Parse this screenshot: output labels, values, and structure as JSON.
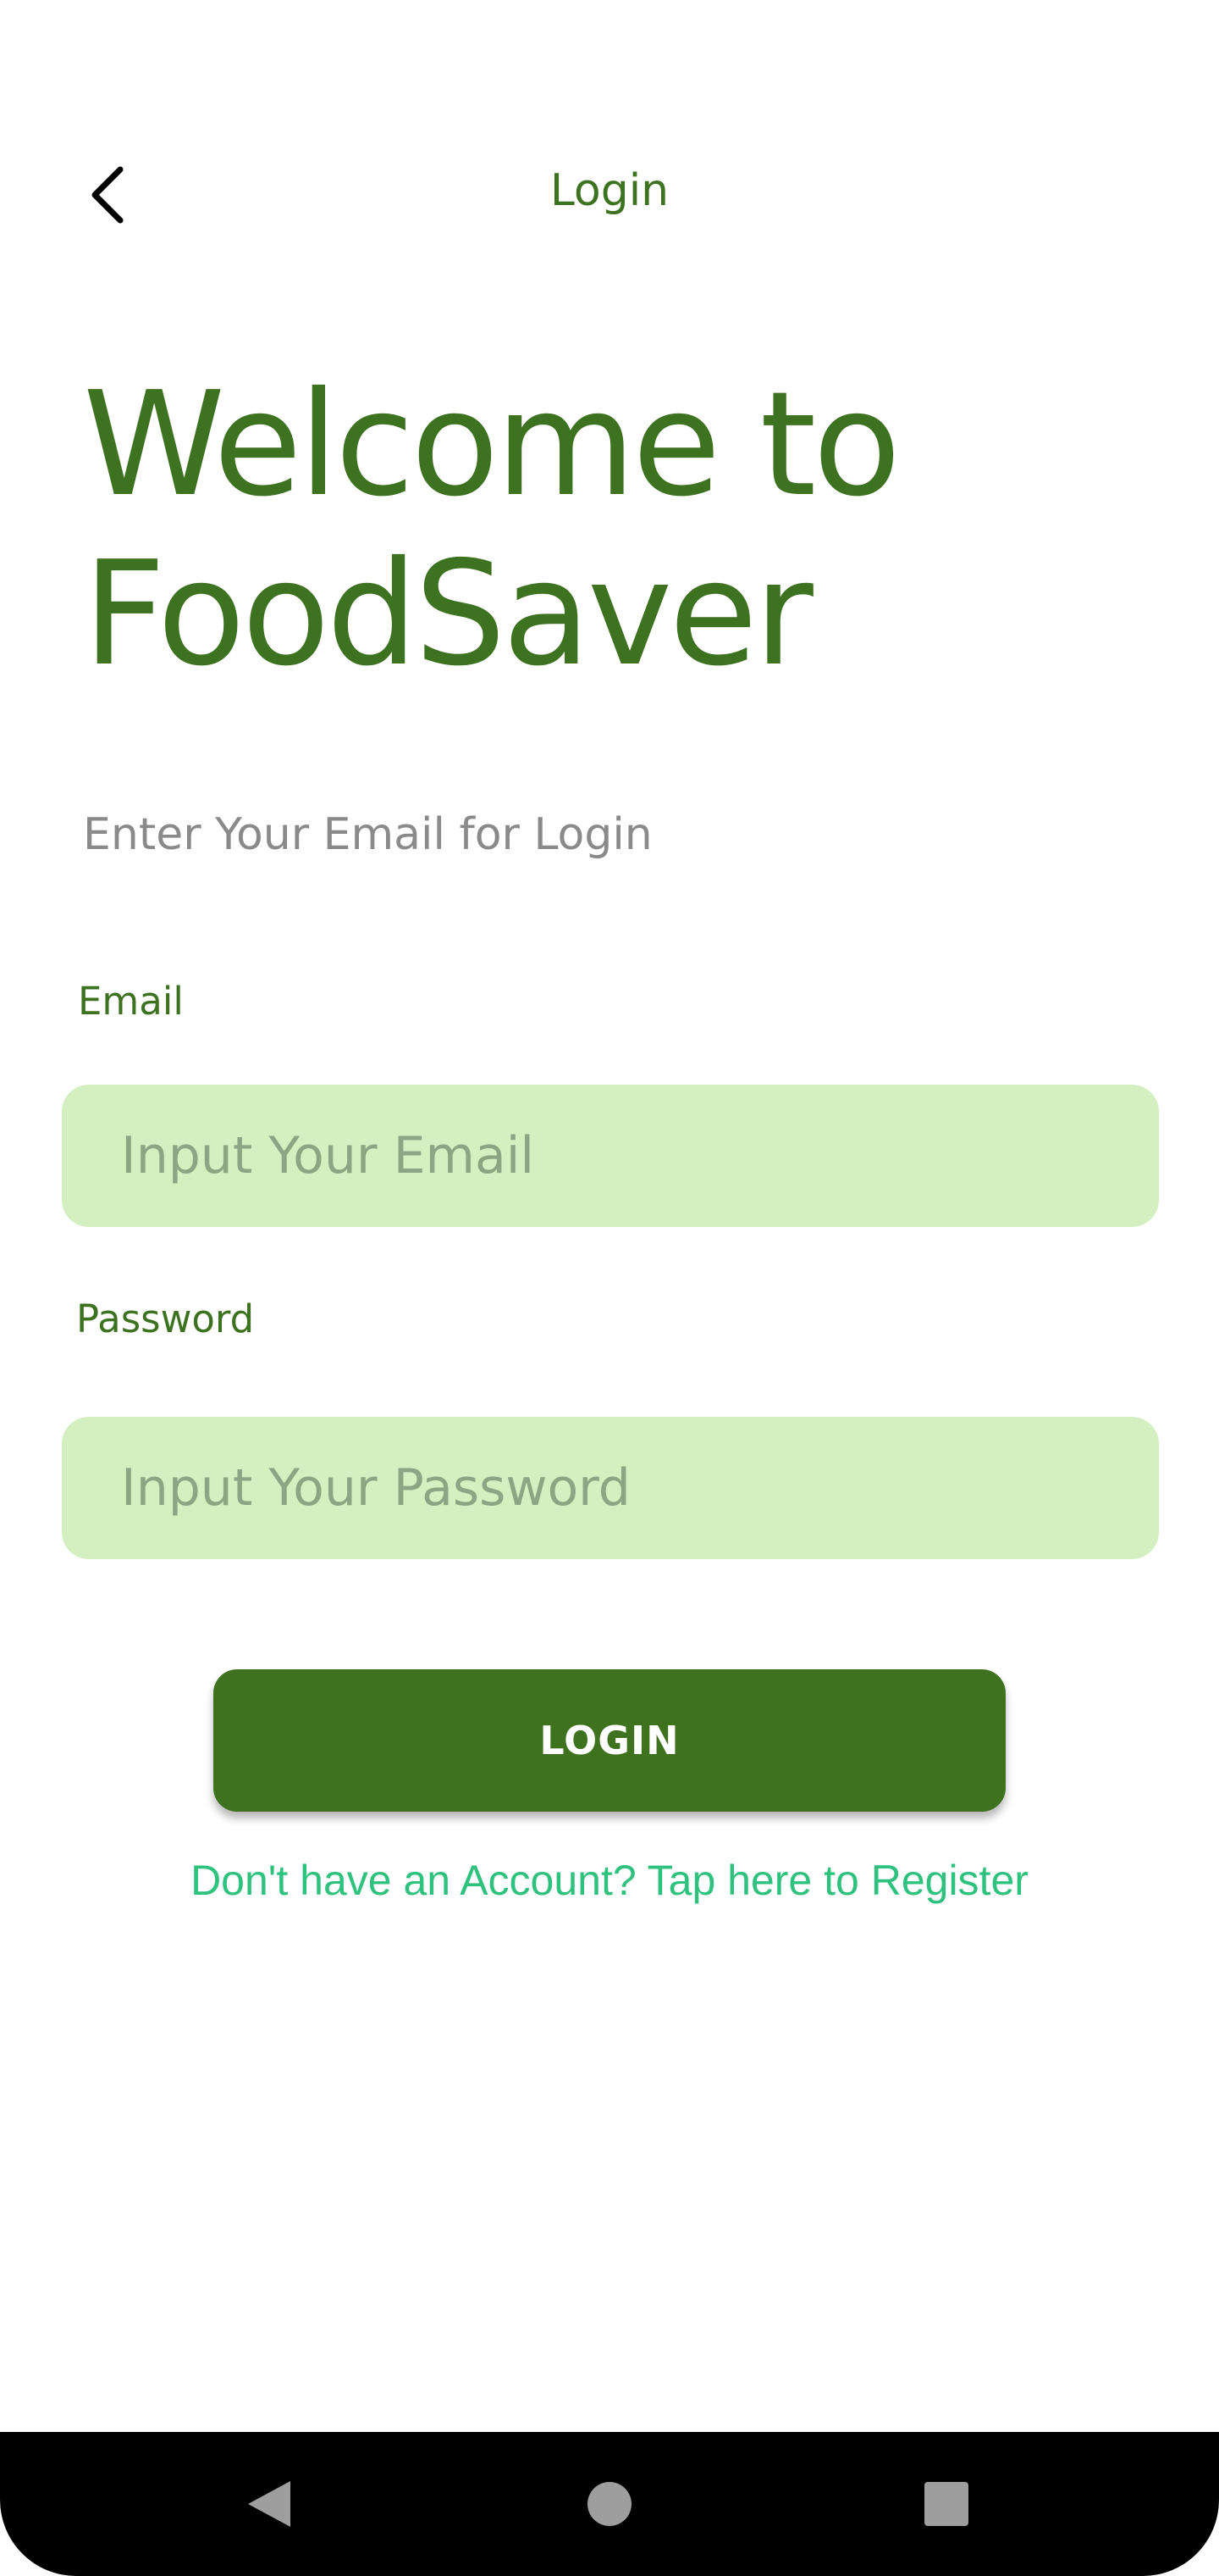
{
  "app_bar": {
    "back_icon": "chevron-left-icon",
    "title": "Login"
  },
  "headline": "Welcome to FoodSaver",
  "subtitle": "Enter Your Email for Login",
  "form": {
    "email_label": "Email",
    "email_placeholder": "Input Your Email",
    "email_value": "",
    "password_label": "Password",
    "password_placeholder": "Input Your Password",
    "password_value": "",
    "login_button": "LOGIN",
    "register_link": "Don't have an Account? Tap here to Register"
  },
  "nav_bar": {
    "back_icon": "triangle-back-icon",
    "home_icon": "circle-home-icon",
    "recents_icon": "square-recents-icon"
  },
  "colors": {
    "primary": "#3e721f",
    "input_bg": "#d4f0c0",
    "link": "#2ec27e",
    "muted_text": "#8a8a8a"
  }
}
